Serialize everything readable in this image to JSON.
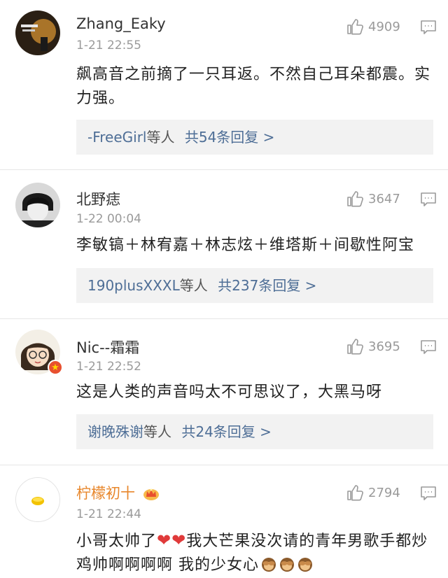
{
  "comments": [
    {
      "user": "Zhang_Eaky",
      "time": "1-21 22:55",
      "likes": "4909",
      "text": "飙高音之前摘了一只耳返。不然自己耳朵都震。实力强。",
      "reply_users": "-FreeGirl",
      "reply_suffix": "等人",
      "reply_count": "共54条回复 >"
    },
    {
      "user": "北野痣",
      "time": "1-22 00:04",
      "likes": "3647",
      "text": "李敏镐＋林宥嘉＋林志炫＋维塔斯＋间歇性阿宝",
      "reply_users": "190plusXXXL",
      "reply_suffix": "等人",
      "reply_count": "共237条回复 >"
    },
    {
      "user": "Nic--霜霜",
      "time": "1-21 22:52",
      "likes": "3695",
      "text": "这是人类的声音吗太不可思议了，大黑马呀",
      "reply_users": "谢晚殊谢",
      "reply_suffix": "等人",
      "reply_count": "共24条回复 >"
    },
    {
      "user": "柠檬初十",
      "time": "1-21 22:44",
      "likes": "2794",
      "text_part1": "小哥太帅了",
      "heart": "❤",
      "text_part2": "我大芒果没次请的青年男歌手都炒鸡帅啊啊啊啊  我的少女心"
    }
  ],
  "colors": {
    "link_blue": "#4e6e96",
    "vip_orange": "#e8872c",
    "heart_red": "#e03a3a",
    "muted": "#9a9a9a"
  },
  "icons": [
    "thumbs-up-icon",
    "comment-icon",
    "heart-emoji",
    "see-no-evil-monkey-emoji",
    "crown-icon",
    "verified-badge-icon"
  ]
}
